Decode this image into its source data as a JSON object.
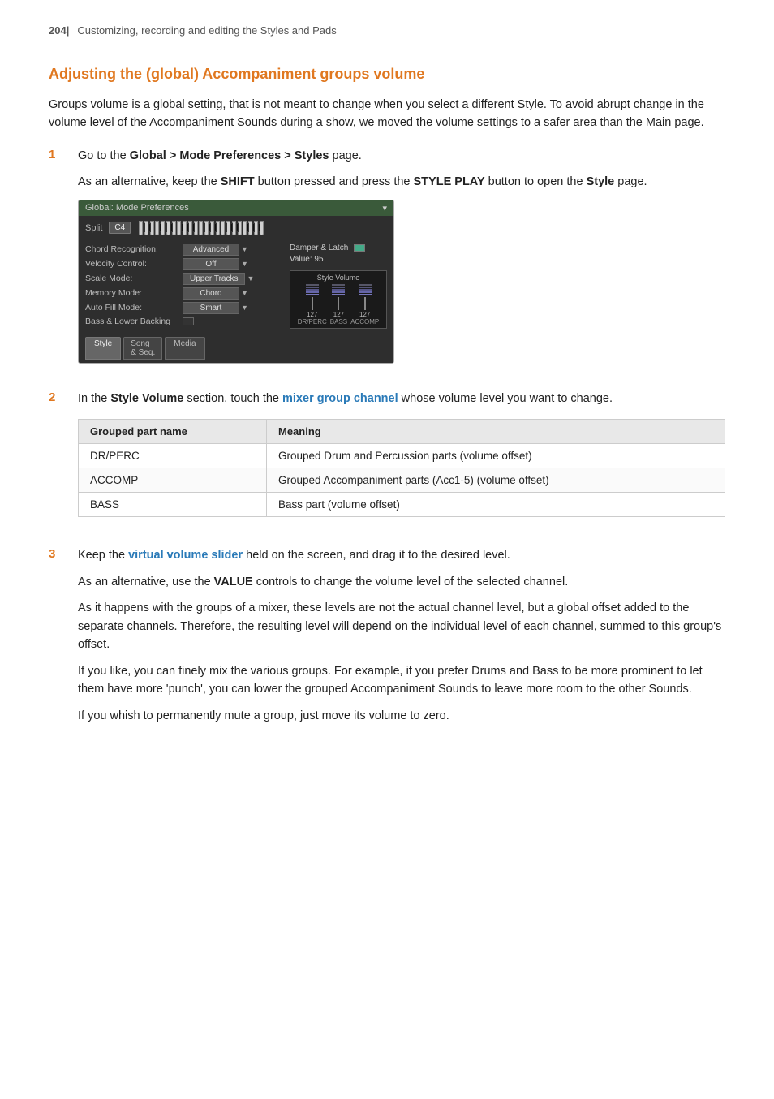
{
  "header": {
    "page_num": "204|",
    "subtitle": "Customizing, recording and editing the Styles and Pads"
  },
  "section_title": "Adjusting the (global) Accompaniment groups volume",
  "intro_paragraphs": [
    "Groups volume is a global setting, that is not meant to change when you select a different Style. To avoid abrupt change in the volume level of the Accompaniment Sounds during a show, we moved the volume settings to a safer area than the Main page."
  ],
  "steps": [
    {
      "num": "1",
      "lines": [
        {
          "text": "Go to the Global > Mode Preferences > Styles page.",
          "parts": [
            {
              "t": "Go to the "
            },
            {
              "t": "Global > Mode Preferences > Styles",
              "bold": true
            },
            {
              "t": " page."
            }
          ]
        },
        {
          "text": "As an alternative, keep the SHIFT button pressed and press the STYLE PLAY button to open the Style page.",
          "parts": [
            {
              "t": "As an alternative, keep the "
            },
            {
              "t": "SHIFT",
              "bold": true
            },
            {
              "t": " button pressed and press the "
            },
            {
              "t": "STYLE PLAY",
              "bold": true
            },
            {
              "t": " button to open the "
            },
            {
              "t": "Style",
              "bold": true
            },
            {
              "t": " page."
            }
          ]
        }
      ],
      "has_panel": true
    },
    {
      "num": "2",
      "lines": [
        {
          "parts": [
            {
              "t": "In the "
            },
            {
              "t": "Style Volume",
              "bold": true
            },
            {
              "t": " section, touch the "
            },
            {
              "t": "mixer group channel",
              "color": true
            },
            {
              "t": " whose volume level you want to change."
            }
          ]
        }
      ],
      "has_table": true
    },
    {
      "num": "3",
      "lines": [
        {
          "parts": [
            {
              "t": "Keep the "
            },
            {
              "t": "virtual volume slider",
              "color": true
            },
            {
              "t": " held on the screen, and drag it to the desired level."
            }
          ]
        },
        {
          "parts": [
            {
              "t": "As an alternative, use the "
            },
            {
              "t": "VALUE",
              "bold": true
            },
            {
              "t": " controls to change the volume level of the selected channel."
            }
          ]
        },
        {
          "parts": [
            {
              "t": "As it happens with the groups of a mixer, these levels are not the actual channel level, but a global offset added to the separate channels. Therefore, the resulting level will depend on the individual level of each channel, summed to this group's offset."
            }
          ]
        },
        {
          "parts": [
            {
              "t": "If you like, you can finely mix the various groups. For example, if you prefer Drums and Bass to be more prominent to let them have more 'punch', you can lower the grouped Accompaniment Sounds to leave more room to the other Sounds."
            }
          ]
        },
        {
          "parts": [
            {
              "t": "If you whish to permanently mute a group, just move its volume to zero."
            }
          ]
        }
      ]
    }
  ],
  "panel": {
    "title": "Global: Mode Preferences",
    "split_label": "Split",
    "split_value": "C4",
    "settings_rows": [
      {
        "label": "Chord Recognition:",
        "value": "Advanced",
        "right": "Damper & Latch"
      },
      {
        "label": "Velocity Control:",
        "value": "Off",
        "right": "Value: 95"
      },
      {
        "label": "Scale Mode:",
        "value": "Upper Tracks",
        "right": ""
      },
      {
        "label": "Memory Mode:",
        "value": "Chord",
        "right": ""
      },
      {
        "label": "Auto Fill Mode:",
        "value": "Smart",
        "right": "Style Volume"
      },
      {
        "label": "Bass & Lower Backing",
        "value": "",
        "right": ""
      }
    ],
    "style_volume": {
      "title": "Style Volume",
      "bars": [
        {
          "label": "DR/PERC",
          "value": "127"
        },
        {
          "label": "BASS",
          "value": "127"
        },
        {
          "label": "ACCOMP",
          "value": "127"
        }
      ]
    },
    "tabs": [
      "Style",
      "Song & Seq.",
      "Media"
    ]
  },
  "table": {
    "headers": [
      "Grouped part name",
      "Meaning"
    ],
    "rows": [
      {
        "name": "DR/PERC",
        "meaning": "Grouped Drum and Percussion parts (volume offset)"
      },
      {
        "name": "ACCOMP",
        "meaning": "Grouped Accompaniment parts (Acc1-5) (volume offset)"
      },
      {
        "name": "BASS",
        "meaning": "Bass part (volume offset)"
      }
    ]
  }
}
